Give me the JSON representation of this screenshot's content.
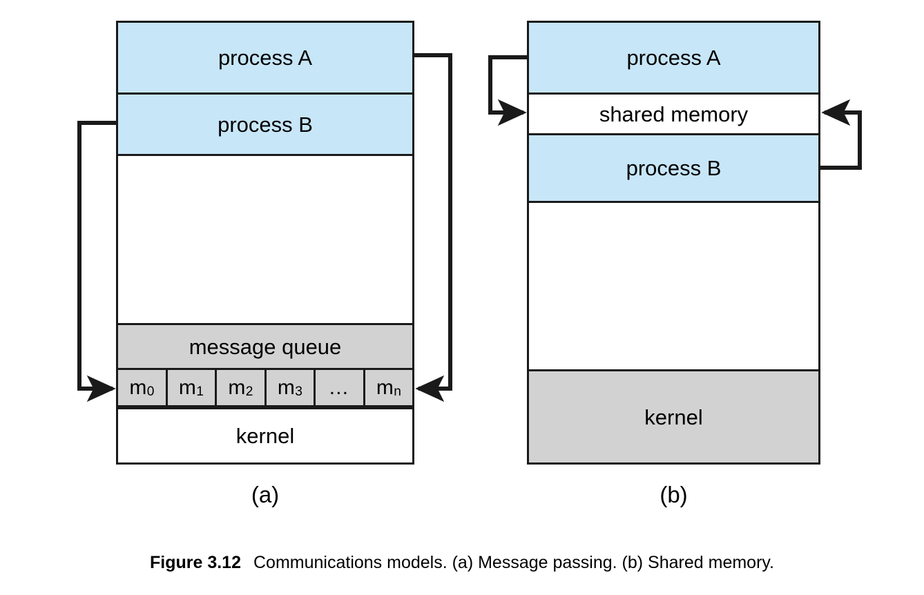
{
  "figure": {
    "label": "Figure 3.12",
    "caption_text": "Communications models. (a) Message passing. (b) Shared memory.",
    "colors": {
      "process_fill": "#c7e6f8",
      "kernel_fill": "#d2d2d2",
      "queue_fill": "#d2d2d2",
      "shared_memory_fill": "#ffffff",
      "stroke": "#1a1a1a",
      "background": "#ffffff"
    }
  },
  "panel_a": {
    "sublabel": "(a)",
    "model_name": "Message passing",
    "bands": [
      {
        "label": "process A",
        "fill": "process"
      },
      {
        "label": "process B",
        "fill": "process"
      },
      {
        "label": "",
        "fill": "empty"
      },
      {
        "label": "message queue",
        "fill": "queue"
      },
      {
        "label": "kernel",
        "fill": "white"
      }
    ],
    "messages": [
      {
        "base": "m",
        "sub": "0"
      },
      {
        "base": "m",
        "sub": "1"
      },
      {
        "base": "m",
        "sub": "2"
      },
      {
        "base": "m",
        "sub": "3"
      },
      {
        "base": "…",
        "sub": ""
      },
      {
        "base": "m",
        "sub": "n"
      }
    ],
    "arrows": [
      {
        "name": "process-b-to-queue-head",
        "from": "process B",
        "to": "m0",
        "direction": "left-then-down-then-right"
      },
      {
        "name": "process-a-to-queue-tail",
        "from": "process A",
        "to": "mn",
        "direction": "right-then-down-then-left"
      }
    ]
  },
  "panel_b": {
    "sublabel": "(b)",
    "model_name": "Shared memory",
    "bands": [
      {
        "label": "process A",
        "fill": "process"
      },
      {
        "label": "shared memory",
        "fill": "white"
      },
      {
        "label": "process B",
        "fill": "process"
      },
      {
        "label": "",
        "fill": "empty"
      },
      {
        "label": "kernel",
        "fill": "kernel"
      }
    ],
    "arrows": [
      {
        "name": "process-a-to-shared-memory",
        "from": "process A",
        "to": "shared memory",
        "direction": "left-then-down-then-right"
      },
      {
        "name": "process-b-to-shared-memory",
        "from": "process B",
        "to": "shared memory",
        "direction": "right-then-up-then-left"
      }
    ]
  }
}
